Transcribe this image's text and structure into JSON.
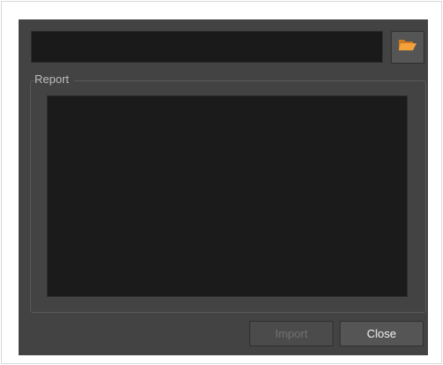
{
  "path_field": {
    "value": ""
  },
  "browse_button": {
    "icon": "folder-open-icon",
    "icon_color": "#f5a13a"
  },
  "report_group": {
    "title": "Report",
    "content": ""
  },
  "buttons": {
    "import_label": "Import",
    "close_label": "Close"
  },
  "colors": {
    "dialog_bg": "#434343",
    "field_bg": "#1a1a1a",
    "accent": "#f5a13a"
  }
}
